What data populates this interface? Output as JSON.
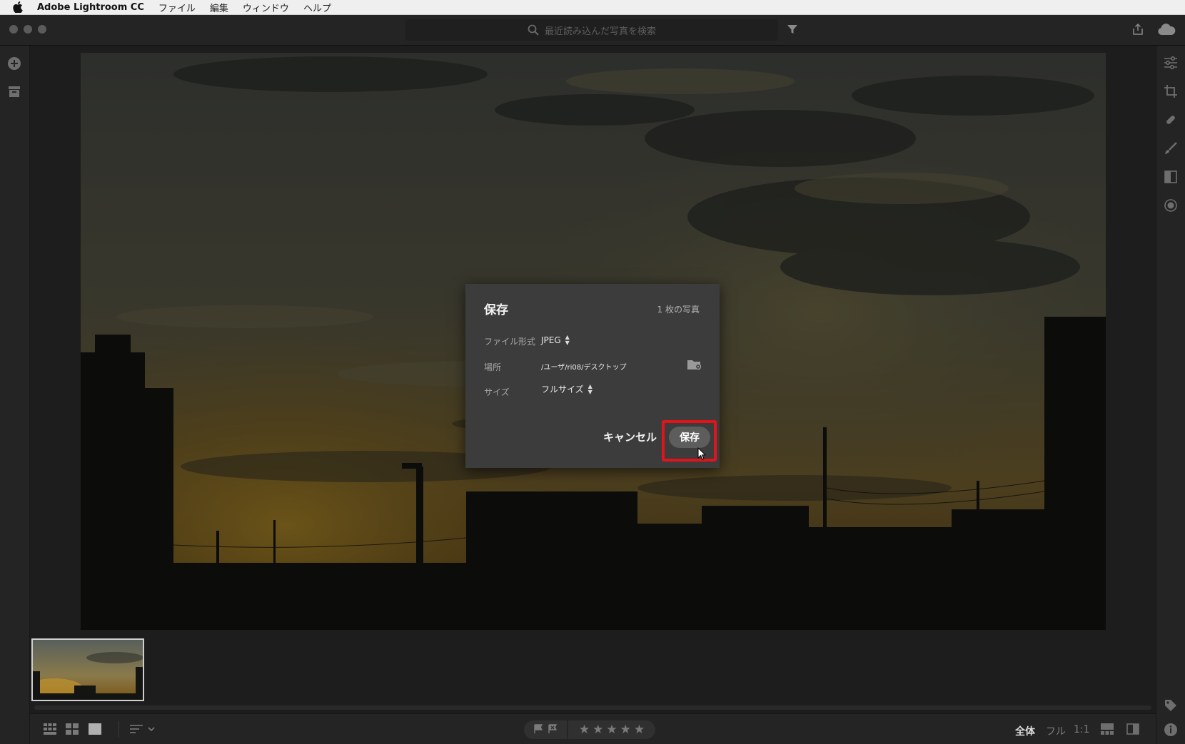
{
  "menubar": {
    "app_name": "Adobe Lightroom CC",
    "items": [
      "ファイル",
      "編集",
      "ウィンドウ",
      "ヘルプ"
    ]
  },
  "search": {
    "placeholder": "最近読み込んだ写真を検索"
  },
  "dialog": {
    "title": "保存",
    "photo_count": "1 枚の写真",
    "file_format_label": "ファイル形式",
    "file_format_value": "JPEG",
    "location_label": "場所",
    "location_value": "/ユーザ/ri08/デスクトップ",
    "size_label": "サイズ",
    "size_value": "フルサイズ",
    "cancel_label": "キャンセル",
    "save_label": "保存"
  },
  "bottombar": {
    "zoom_fit": "全体",
    "zoom_fill": "フル",
    "zoom_1to1": "1:1",
    "stars": [
      "★",
      "★",
      "★",
      "★",
      "★"
    ]
  },
  "colors": {
    "highlight": "#e2141b",
    "dialog_bg": "#3c3c3c",
    "app_bg": "#1d1d1d"
  }
}
